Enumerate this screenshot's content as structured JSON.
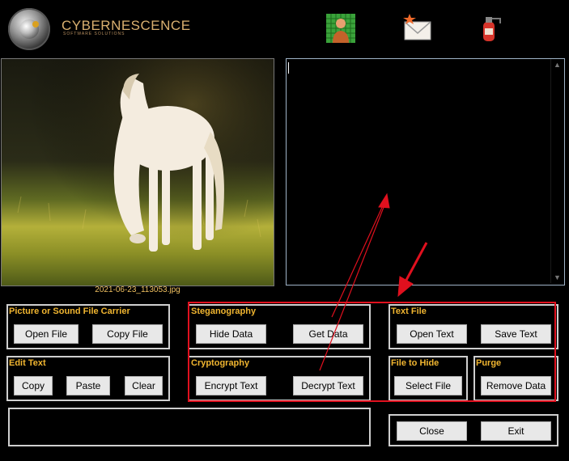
{
  "brand": {
    "name": "CYBERNESCENCE",
    "tagline": "SOFTWARE SOLUTIONS"
  },
  "header_icons": [
    "user-grid-icon",
    "mail-star-icon",
    "extinguisher-icon"
  ],
  "image": {
    "caption": "2021-06-23_113053.jpg"
  },
  "groups": {
    "carrier": {
      "title": "Picture or Sound File Carrier",
      "open": "Open File",
      "copy": "Copy File"
    },
    "edit": {
      "title": "Edit Text",
      "copy": "Copy",
      "paste": "Paste",
      "clear": "Clear"
    },
    "steg": {
      "title": "Steganography",
      "hide": "Hide Data",
      "get": "Get Data"
    },
    "crypto": {
      "title": "Cryptography",
      "encrypt": "Encrypt Text",
      "decrypt": "Decrypt Text"
    },
    "textfile": {
      "title": "Text File",
      "open": "Open Text",
      "save": "Save Text"
    },
    "hide": {
      "title": "File to Hide",
      "select": "Select File"
    },
    "purge": {
      "title": "Purge",
      "remove": "Remove Data"
    },
    "window": {
      "close": "Close",
      "exit": "Exit"
    }
  },
  "colors": {
    "annotation": "#e0101e",
    "group_title": "#f0b530",
    "caption": "#f0c060"
  }
}
